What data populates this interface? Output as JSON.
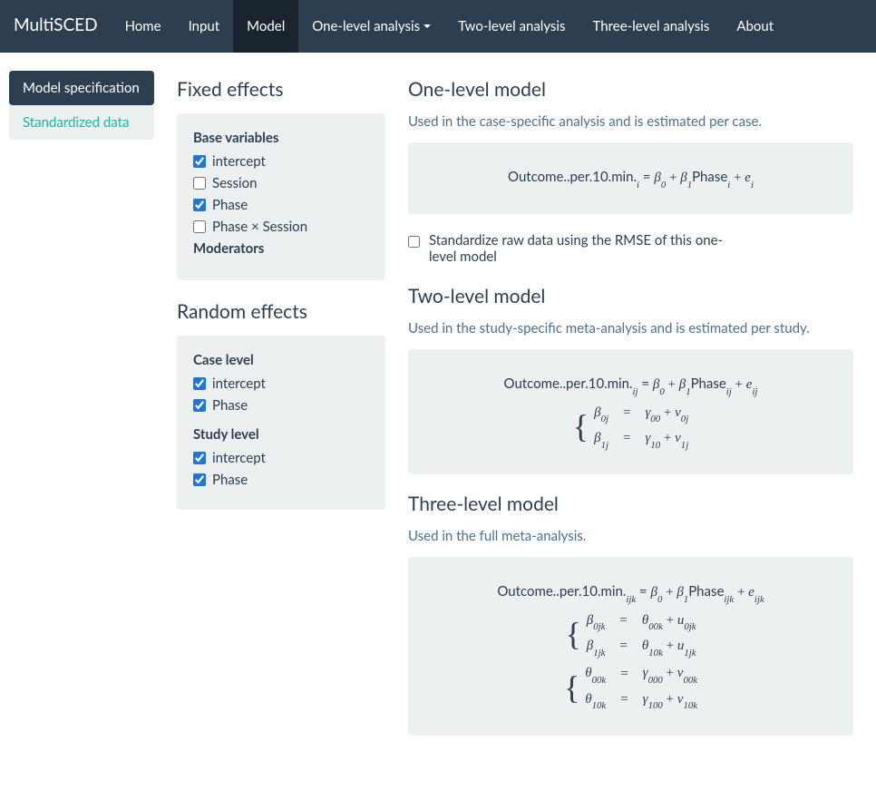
{
  "brand": "MultiSCED",
  "nav": {
    "home": "Home",
    "input": "Input",
    "model": "Model",
    "one_level": "One-level analysis",
    "two_level": "Two-level analysis",
    "three_level": "Three-level analysis",
    "about": "About"
  },
  "sidebar": {
    "model_spec": "Model specification",
    "std_data": "Standardized data"
  },
  "fixed": {
    "title": "Fixed effects",
    "base_label": "Base variables",
    "intercept": "intercept",
    "session": "Session",
    "phase": "Phase",
    "phase_session": "Phase × Session",
    "moderators": "Moderators"
  },
  "random": {
    "title": "Random effects",
    "case_label": "Case level",
    "case_intercept": "intercept",
    "case_phase": "Phase",
    "study_label": "Study level",
    "study_intercept": "intercept",
    "study_phase": "Phase"
  },
  "models": {
    "one": {
      "title": "One-level model",
      "desc": "Used in the case-specific analysis and is estimated per case."
    },
    "standardize_label": "Standardize raw data using the RMSE of this one-level model",
    "two": {
      "title": "Two-level model",
      "desc": "Used in the study-specific meta-analysis and is estimated per study."
    },
    "three": {
      "title": "Three-level model",
      "desc": "Used in the full meta-analysis."
    },
    "outcome_var": "Outcome..per.10.min.",
    "phase_var": "Phase"
  },
  "checked": {
    "fixed_intercept": true,
    "fixed_session": false,
    "fixed_phase": true,
    "fixed_phase_session": false,
    "random_case_intercept": true,
    "random_case_phase": true,
    "random_study_intercept": true,
    "random_study_phase": true,
    "standardize": false
  }
}
